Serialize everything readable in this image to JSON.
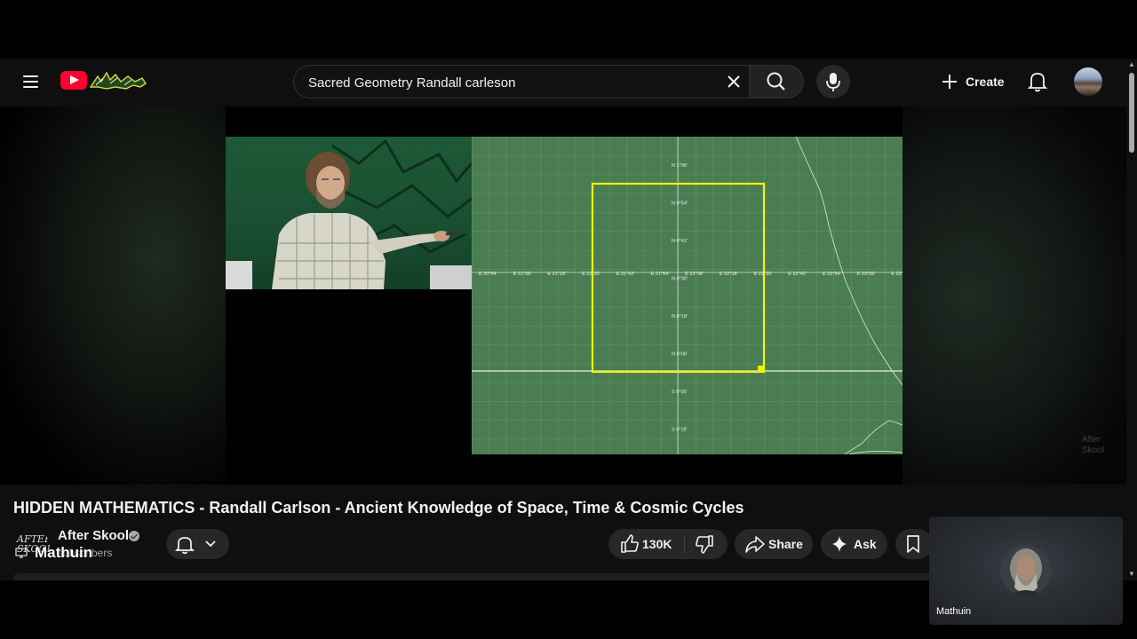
{
  "header": {
    "search_value": "Sacred Geometry Randall carleson",
    "create_label": "Create"
  },
  "video": {
    "title": "HIDDEN MATHEMATICS - Randall Carlson - Ancient Knowledge of Space, Time & Cosmic Cycles",
    "map_lon_labels": [
      "E 20°54'",
      "E 21°06'",
      "E 21°18'",
      "E 21°30'",
      "E 21°42'",
      "E 21°54'",
      "E 22°06'",
      "E 22°18'",
      "E 22°30'",
      "E 22°42'",
      "E 22°54'",
      "E 23°06'",
      "E 23°"
    ],
    "map_lat_labels": [
      "N 1°06'",
      "N 0°54'",
      "N 0°42'",
      "N 0°30'",
      "N 0°18'",
      "N 0°06'",
      "S 0°06'",
      "S 0°18'"
    ],
    "watermark": [
      "After",
      "Skool"
    ]
  },
  "channel": {
    "name": "After Skool",
    "subscribers": "subscribers",
    "avatar_text": [
      "AFTER",
      "SKOOL"
    ]
  },
  "overlay": {
    "name": "Mathuin"
  },
  "actions": {
    "likes": "130K",
    "share": "Share",
    "ask": "Ask"
  },
  "pip": {
    "name": "Mathuin"
  },
  "colors": {
    "brand_red": "#ff0033",
    "map_green": "#4a7d52",
    "highlight_yellow": "#f2f20a"
  }
}
